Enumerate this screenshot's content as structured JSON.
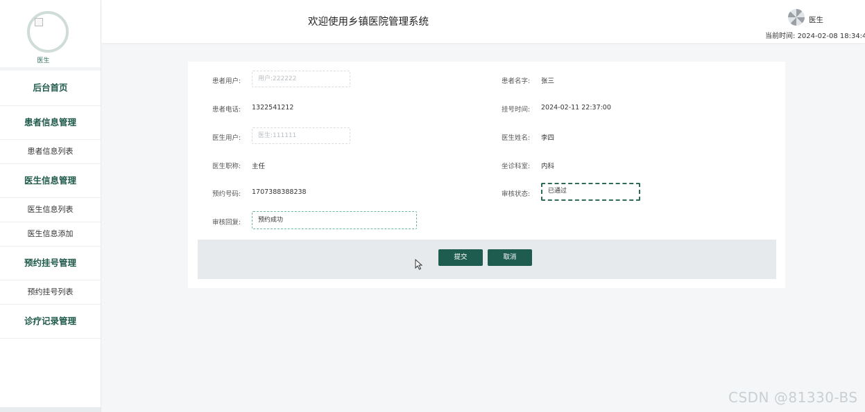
{
  "sidebar": {
    "role": "医生",
    "menu": [
      {
        "label": "后台首页"
      },
      {
        "label": "患者信息管理"
      },
      {
        "label": "患者信息列表"
      },
      {
        "label": "医生信息管理"
      },
      {
        "label": "医生信息列表"
      },
      {
        "label": "医生信息添加"
      },
      {
        "label": "预约挂号管理"
      },
      {
        "label": "预约挂号列表"
      },
      {
        "label": "诊疗记录管理"
      }
    ]
  },
  "header": {
    "title": "欢迎使用乡镇医院管理系统",
    "user_name": "医生",
    "time_label": "当前时间:",
    "time_value": "2024-02-08 18:34:4"
  },
  "form": {
    "patient_user": {
      "label": "患者用户:",
      "placeholder": "用户:222222"
    },
    "patient_name": {
      "label": "患者名字:",
      "value": "张三"
    },
    "patient_phone": {
      "label": "患者电话:",
      "value": "1322541212"
    },
    "register_time": {
      "label": "挂号时间:",
      "value": "2024-02-11 22:37:00"
    },
    "doctor_user": {
      "label": "医生用户:",
      "placeholder": "医生:111111"
    },
    "doctor_name": {
      "label": "医生姓名:",
      "value": "李四"
    },
    "doctor_title": {
      "label": "医生职称:",
      "value": "主任"
    },
    "department": {
      "label": "坐诊科室:",
      "value": "内科"
    },
    "appointment_no": {
      "label": "预约号码:",
      "value": "1707388388238"
    },
    "review_status": {
      "label": "审核状态:",
      "value": "已通过"
    },
    "review_reply": {
      "label": "审核回复:",
      "value": "预约成功"
    }
  },
  "buttons": {
    "submit": "提交",
    "cancel": "取消"
  },
  "watermark": "CSDN @81330-BS",
  "colors": {
    "primary": "#1f5c50",
    "menu_text": "#1f5a4b",
    "background": "#f4f6f7"
  }
}
